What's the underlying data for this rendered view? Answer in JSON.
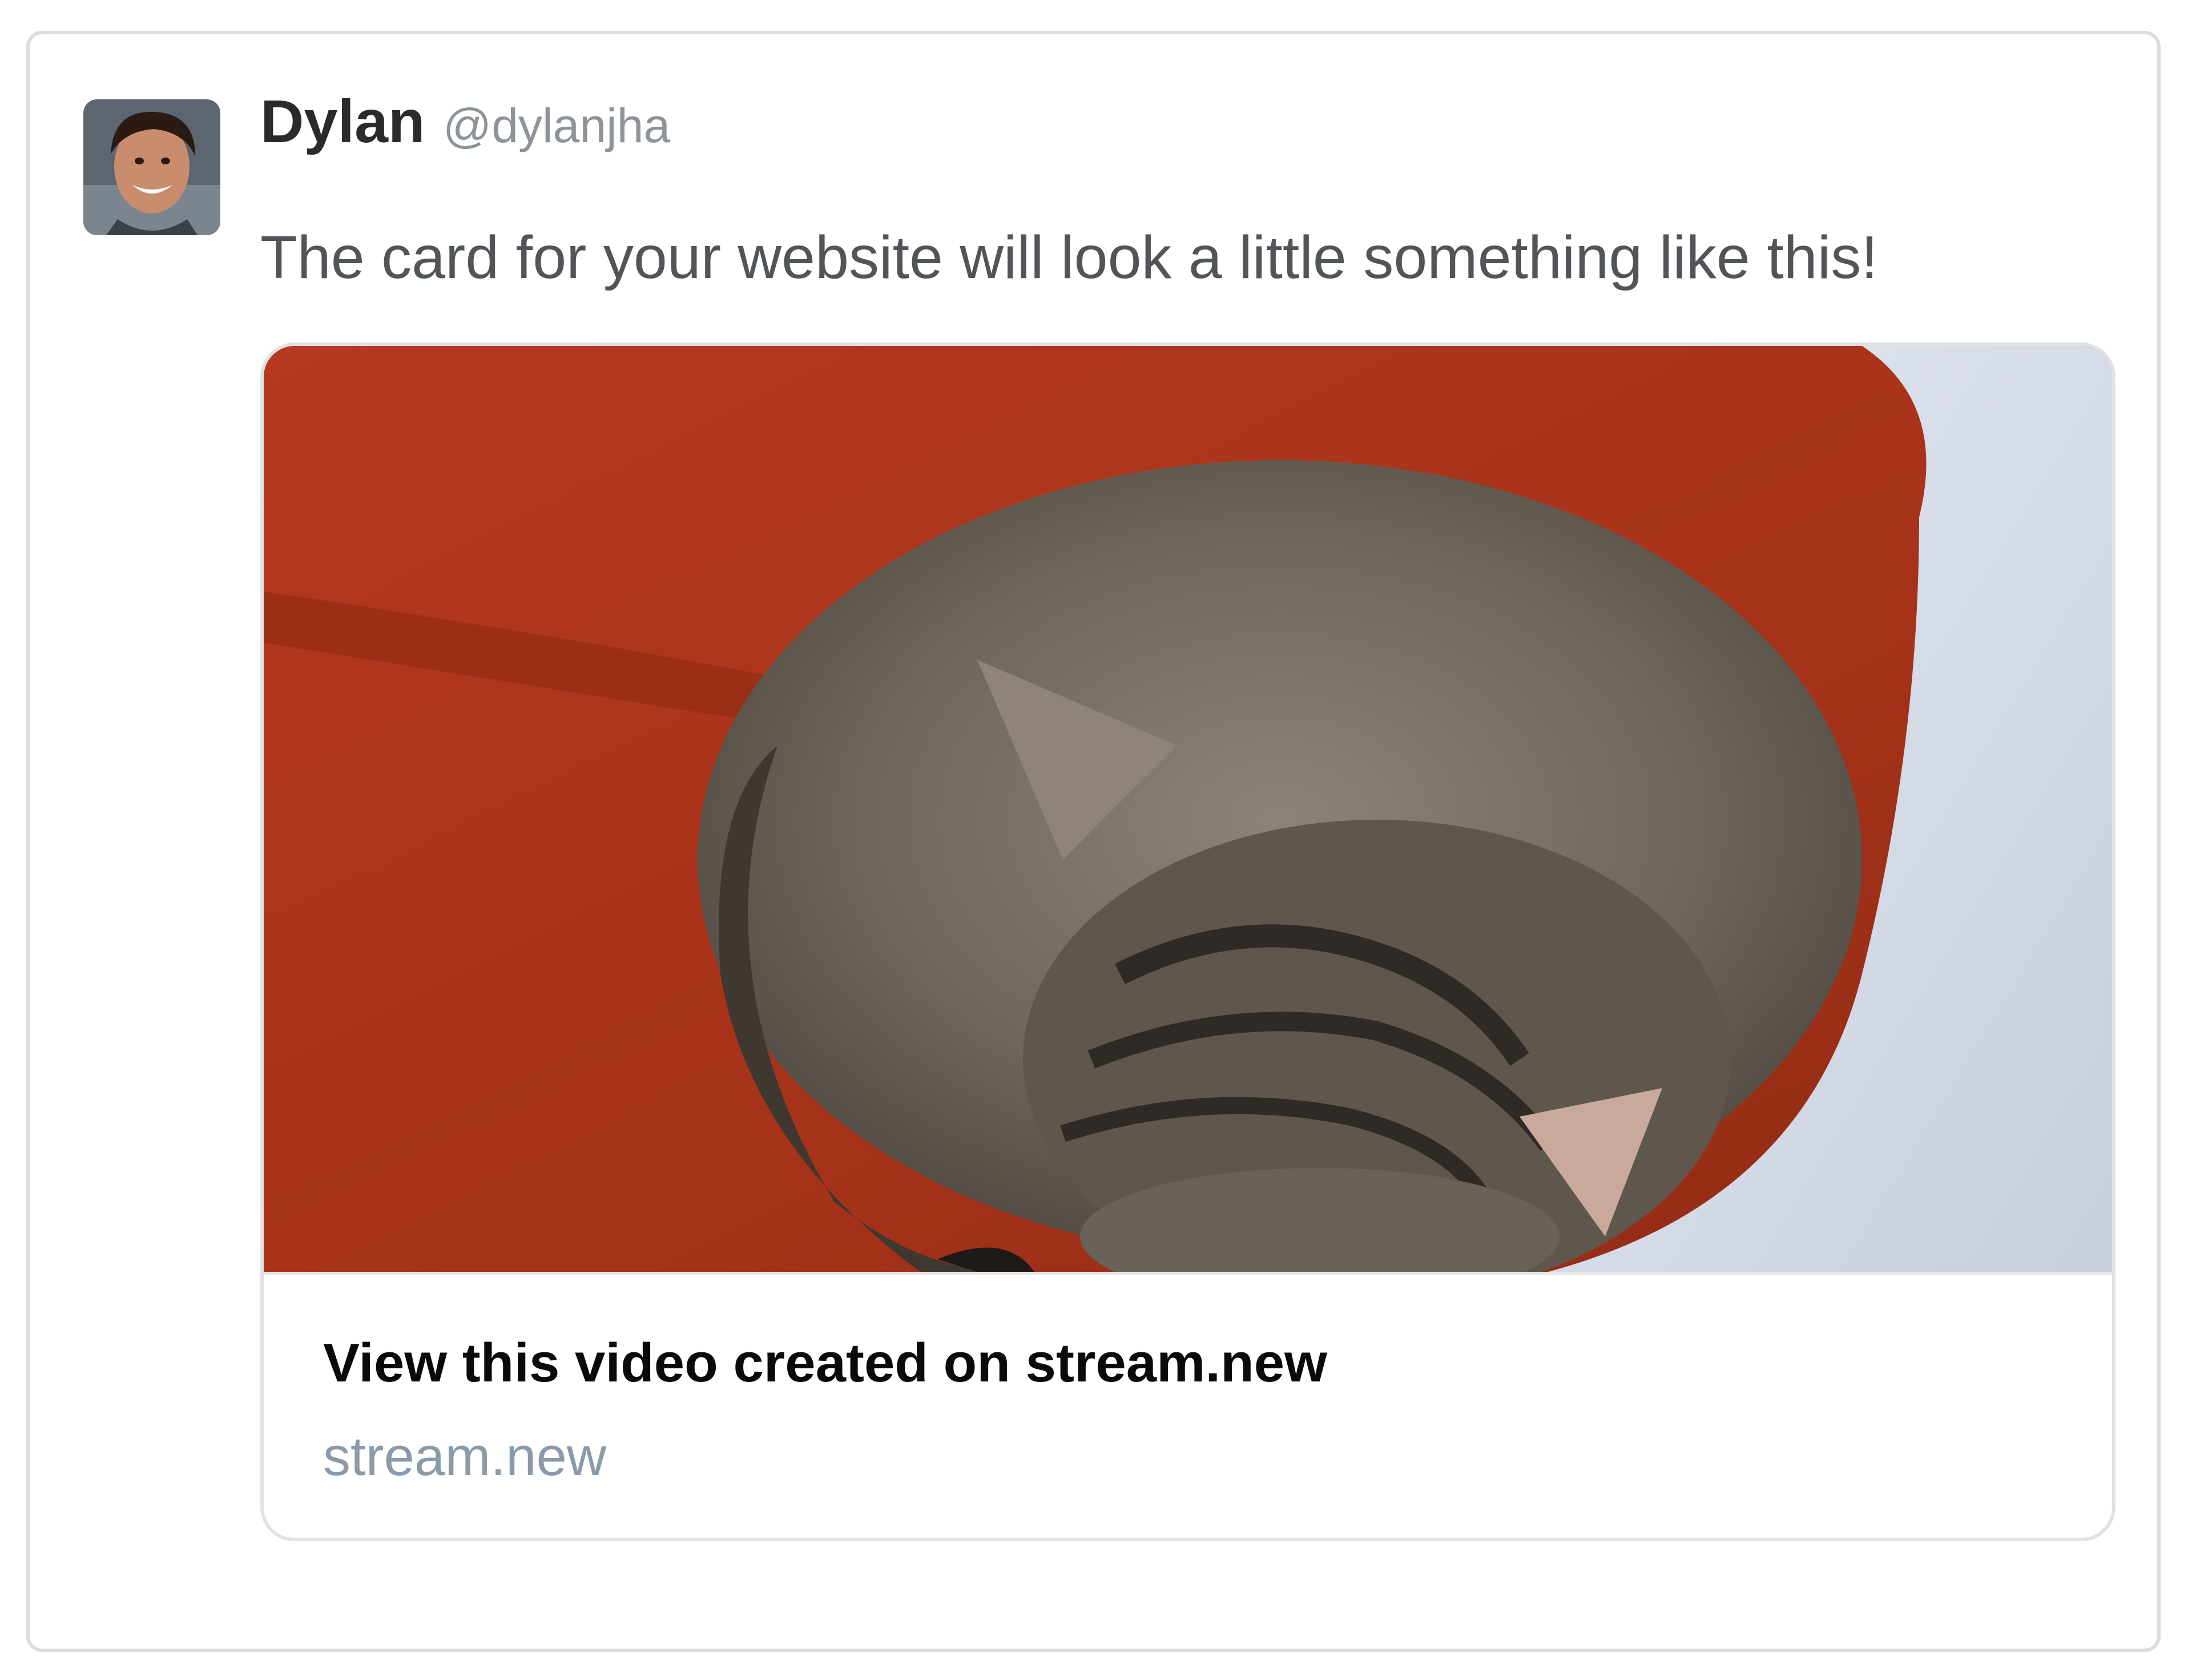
{
  "tweet": {
    "author_name": "Dylan",
    "author_handle": "@dylanjha",
    "text": "The card for your website will look a little something like this!",
    "avatar": "user-avatar-photo"
  },
  "link_card": {
    "media": "sleeping-tabby-cat-video-thumbnail",
    "title": "View this video created on stream.new",
    "domain": "stream.new"
  },
  "colors": {
    "card_border": "#dadde0",
    "name_text": "#2b2b2b",
    "handle_text": "#8d9399",
    "body_text": "#515559",
    "link_title": "#0a0a0a",
    "link_domain": "#8a9aa8"
  }
}
